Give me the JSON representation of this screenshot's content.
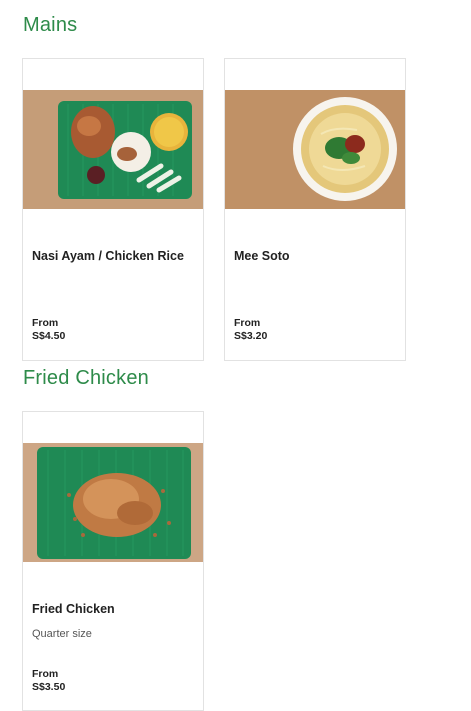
{
  "sections": [
    {
      "title": "Mains",
      "items": [
        {
          "name": "Nasi Ayam / Chicken Rice",
          "from_label": "From",
          "price": "S$4.50"
        },
        {
          "name": "Mee Soto",
          "from_label": "From",
          "price": "S$3.20"
        }
      ]
    },
    {
      "title": "Fried Chicken",
      "items": [
        {
          "name": "Fried Chicken",
          "description": "Quarter size",
          "from_label": "From",
          "price": "S$3.50"
        }
      ]
    }
  ],
  "colors": {
    "section_title": "#2e8b4a",
    "card_border": "#e2e2e2",
    "banana_leaf": "#1f8a55",
    "table_wood": "#c9a27d"
  }
}
